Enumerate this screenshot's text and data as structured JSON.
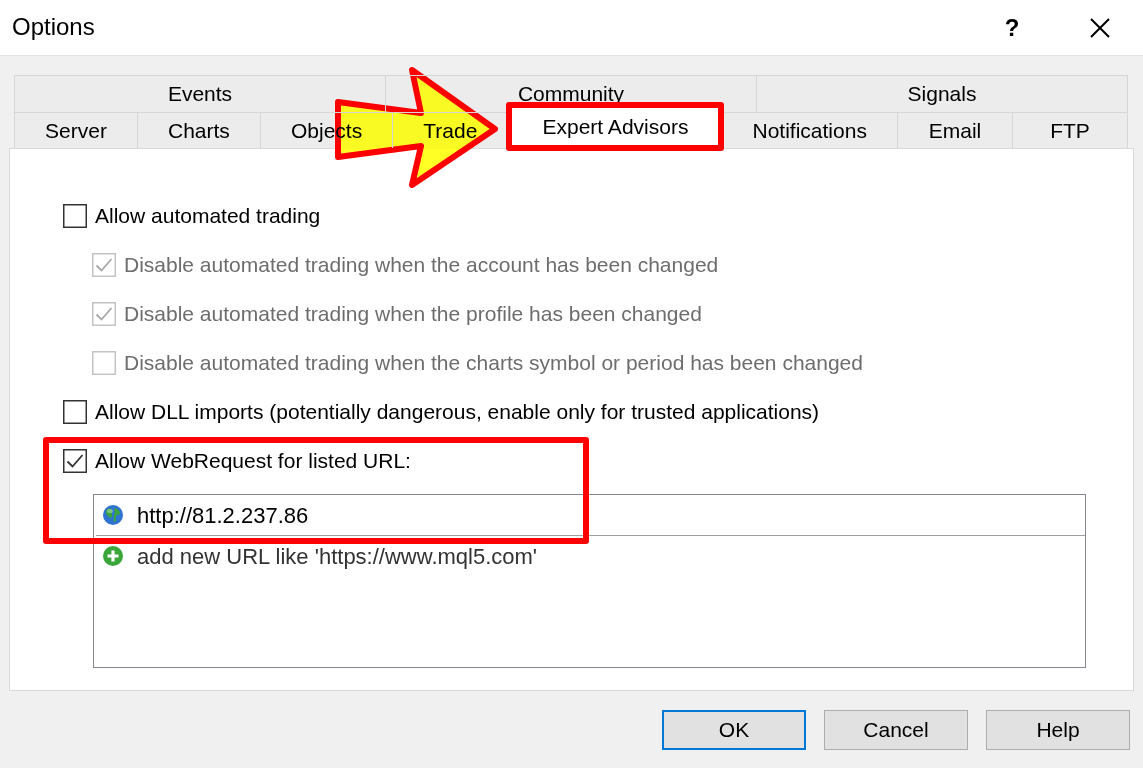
{
  "window": {
    "title": "Options",
    "help": "?"
  },
  "tab_rows": [
    {
      "tabs": [
        {
          "label": "Events",
          "selected": false,
          "highlighted": false
        },
        {
          "label": "Community",
          "selected": false,
          "highlighted": false
        },
        {
          "label": "Signals",
          "selected": false,
          "highlighted": false
        }
      ]
    },
    {
      "tabs": [
        {
          "label": "Server",
          "selected": false,
          "highlighted": false
        },
        {
          "label": "Charts",
          "selected": false,
          "highlighted": false
        },
        {
          "label": "Objects",
          "selected": false,
          "highlighted": false
        },
        {
          "label": "Trade",
          "selected": false,
          "highlighted": false
        },
        {
          "label": "Expert Advisors",
          "selected": true,
          "highlighted": true
        },
        {
          "label": "Notifications",
          "selected": false,
          "highlighted": false
        },
        {
          "label": "Email",
          "selected": false,
          "highlighted": false
        },
        {
          "label": "FTP",
          "selected": false,
          "highlighted": false
        }
      ]
    }
  ],
  "options": [
    {
      "label": "Allow automated trading",
      "checked": false,
      "disabled": false,
      "highlighted": false,
      "children": [
        {
          "label": "Disable automated trading when the account has been changed",
          "checked": true,
          "disabled": true,
          "highlighted": false
        },
        {
          "label": "Disable automated trading when the profile has been changed",
          "checked": true,
          "disabled": true,
          "highlighted": false
        },
        {
          "label": "Disable automated trading when the charts symbol or period has been changed",
          "checked": false,
          "disabled": true,
          "highlighted": false
        }
      ]
    },
    {
      "label": "Allow DLL imports (potentially dangerous, enable only for trusted applications)",
      "checked": false,
      "disabled": false,
      "highlighted": false
    },
    {
      "label": "Allow WebRequest for listed URL:",
      "checked": true,
      "disabled": false,
      "highlighted": true
    }
  ],
  "url_list": {
    "items": [
      {
        "kind": "url",
        "text": "http://81.2.237.86",
        "highlighted": true
      },
      {
        "kind": "add",
        "text": "add new URL like 'https://www.mql5.com'",
        "highlighted": false
      }
    ]
  },
  "buttons": [
    {
      "label": "OK",
      "default": true
    },
    {
      "label": "Cancel",
      "default": false
    },
    {
      "label": "Help",
      "default": false
    }
  ],
  "annotations": [
    {
      "kind": "arrow"
    }
  ]
}
